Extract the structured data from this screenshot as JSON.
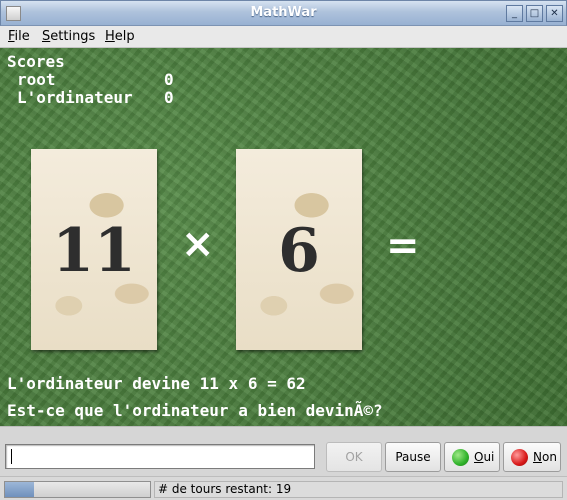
{
  "window": {
    "title": "MathWar"
  },
  "titlebar_buttons": {
    "minimize": "_",
    "maximize": "□",
    "close": "✕"
  },
  "menu": {
    "file": {
      "mnemonic": "F",
      "rest": "ile"
    },
    "settings": {
      "mnemonic": "S",
      "rest": "ettings"
    },
    "help": {
      "mnemonic": "H",
      "rest": "elp"
    }
  },
  "scores": {
    "title": "Scores",
    "rows": [
      {
        "name": "root",
        "value": "0"
      },
      {
        "name": "L'ordinateur",
        "value": "0"
      }
    ]
  },
  "problem": {
    "operand1": "11",
    "operator": "×",
    "operand2": "6",
    "equals": "="
  },
  "messages": {
    "guess": "L'ordinateur devine 11 x 6 = 62",
    "question": "Est-ce que l'ordinateur a bien devinÃ©?"
  },
  "controls": {
    "answer_value": "",
    "ok_label": "OK",
    "pause_label": "Pause",
    "yes": {
      "mnemonic": "O",
      "rest": "ui"
    },
    "no": {
      "mnemonic": "N",
      "rest": "on"
    }
  },
  "colors": {
    "yes_light": "#2fb22a",
    "no_light": "#d81818"
  },
  "status": {
    "progress_fraction": 0.2,
    "text": "# de tours restant: 19"
  }
}
